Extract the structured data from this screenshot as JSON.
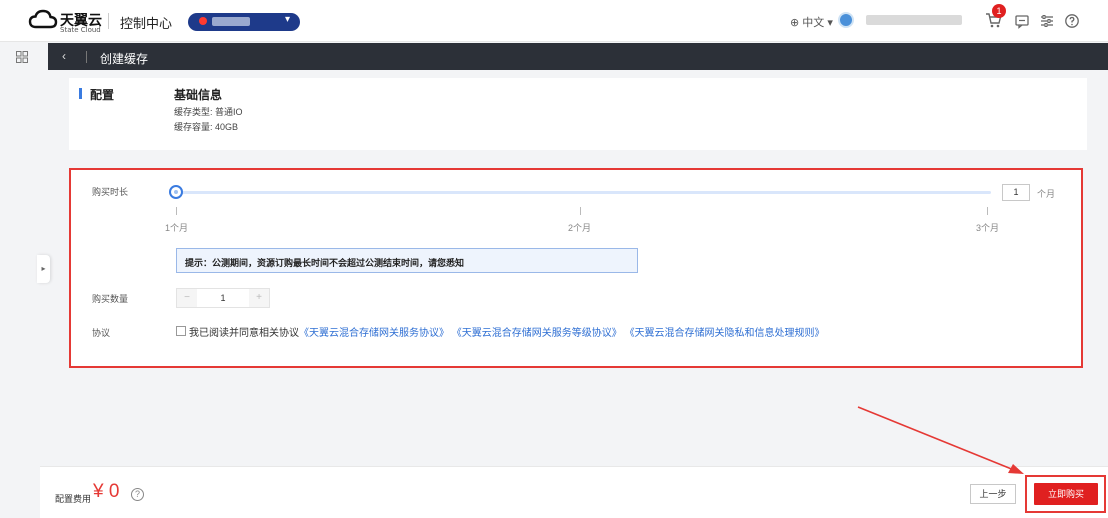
{
  "header": {
    "logo_text": "天翼云",
    "logo_sub": "State Cloud",
    "console_title": "控制中心",
    "language": "⊕ 中文 ▾",
    "cart_badge": "1"
  },
  "subheader": {
    "back_glyph": "‹",
    "title": "创建缓存"
  },
  "config": {
    "section_title": "配置",
    "info_title": "基础信息",
    "cache_type": "缓存类型: 普通IO",
    "cache_capacity": "缓存容量: 40GB"
  },
  "purchase": {
    "duration_label": "购买时长",
    "slider": {
      "min": 1,
      "max": 3,
      "value": 1
    },
    "tick_labels": [
      "1个月",
      "2个月",
      "3个月"
    ],
    "month_value": "1",
    "month_unit": "个月",
    "tip": "提示：公测期间，资源订购最长时间不会超过公测结束时间，请您悉知",
    "quantity_label": "购买数量",
    "quantity_minus": "−",
    "quantity_value": "1",
    "quantity_plus": "+",
    "agreement_label": "协议",
    "agreement_text": "我已阅读并同意相关协议",
    "agreement_links": [
      "《天翼云混合存储网关服务协议》",
      "《天翼云混合存储网关服务等级协议》",
      "《天翼云混合存储网关隐私和信息处理规则》"
    ]
  },
  "footer": {
    "fee_label": "配置费用",
    "fee_value": "¥ 0",
    "help_glyph": "?",
    "prev_button": "上一步",
    "buy_button": "立即购买"
  },
  "colors": {
    "accent": "#3a7be0",
    "danger": "#e53935",
    "subheader_bg": "#2c3038",
    "region_bg": "#1e3a8a"
  },
  "icons": [
    "cloud-logo-icon",
    "region-dot-icon",
    "chevron-down-icon",
    "globe-icon",
    "avatar-icon",
    "cart-icon",
    "message-icon",
    "settings-icon",
    "help-icon",
    "apps-grid-icon",
    "chevron-left-icon",
    "expand-arrow-icon"
  ]
}
